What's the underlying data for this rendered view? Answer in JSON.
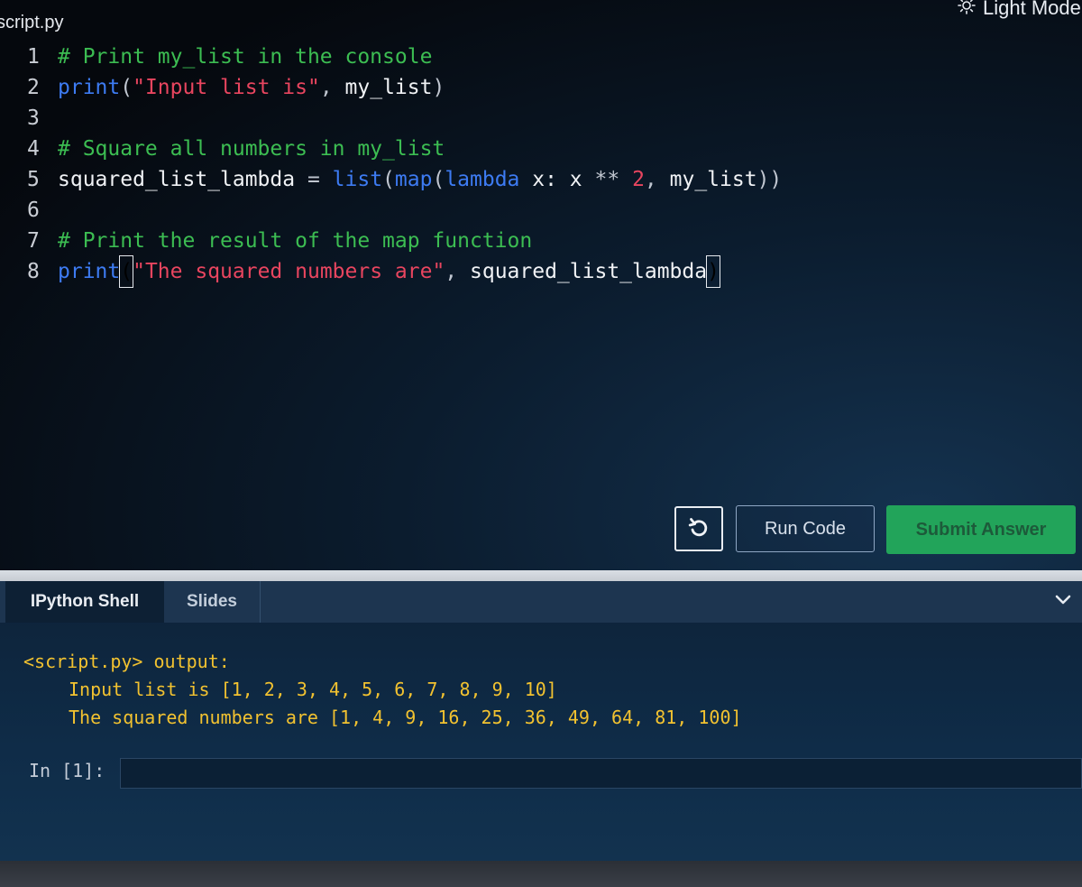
{
  "editor": {
    "file_tab": "script.py",
    "theme_toggle": "Light Mode",
    "lines": [
      {
        "n": "1",
        "tokens": [
          {
            "t": "# Print my_list in the console",
            "c": "comment"
          }
        ]
      },
      {
        "n": "2",
        "tokens": [
          {
            "t": "print",
            "c": "builtin"
          },
          {
            "t": "(",
            "c": "op"
          },
          {
            "t": "\"Input list is\"",
            "c": "string"
          },
          {
            "t": ", ",
            "c": "op"
          },
          {
            "t": "my_list",
            "c": "name"
          },
          {
            "t": ")",
            "c": "op"
          }
        ]
      },
      {
        "n": "3",
        "tokens": []
      },
      {
        "n": "4",
        "tokens": [
          {
            "t": "# Square all numbers in my_list",
            "c": "comment"
          }
        ]
      },
      {
        "n": "5",
        "tokens": [
          {
            "t": "squared_list_lambda",
            "c": "name"
          },
          {
            "t": " = ",
            "c": "op"
          },
          {
            "t": "list",
            "c": "builtin"
          },
          {
            "t": "(",
            "c": "op"
          },
          {
            "t": "map",
            "c": "builtin"
          },
          {
            "t": "(",
            "c": "op"
          },
          {
            "t": "lambda",
            "c": "builtin"
          },
          {
            "t": " x: x ",
            "c": "name"
          },
          {
            "t": "**",
            "c": "op"
          },
          {
            "t": " ",
            "c": "op"
          },
          {
            "t": "2",
            "c": "num"
          },
          {
            "t": ", ",
            "c": "op"
          },
          {
            "t": "my_list",
            "c": "name"
          },
          {
            "t": "))",
            "c": "op"
          }
        ]
      },
      {
        "n": "6",
        "tokens": []
      },
      {
        "n": "7",
        "tokens": [
          {
            "t": "# Print the result of the map function",
            "c": "comment"
          }
        ]
      },
      {
        "n": "8",
        "tokens": [
          {
            "t": "print",
            "c": "builtin"
          },
          {
            "t": "(",
            "c": "cursor"
          },
          {
            "t": "\"The squared numbers are\"",
            "c": "string"
          },
          {
            "t": ", ",
            "c": "op"
          },
          {
            "t": "squared_list_lambda",
            "c": "name"
          },
          {
            "t": ")",
            "c": "cursor"
          }
        ]
      }
    ],
    "buttons": {
      "reset_icon": "reset-icon",
      "run": "Run Code",
      "submit": "Submit Answer"
    }
  },
  "shell": {
    "tabs": [
      {
        "label": "IPython Shell",
        "active": true
      },
      {
        "label": "Slides",
        "active": false
      }
    ],
    "output_header": "<script.py> output:",
    "output_lines": [
      "Input list is [1, 2, 3, 4, 5, 6, 7, 8, 9, 10]",
      "The squared numbers are [1, 4, 9, 16, 25, 36, 49, 64, 81, 100]"
    ],
    "prompt": "In [1]:",
    "input_value": ""
  },
  "colors": {
    "comment": "#3cbd52",
    "builtin": "#3d7bf2",
    "string": "#e8455f",
    "output": "#f2c230",
    "submit": "#22a45a"
  }
}
